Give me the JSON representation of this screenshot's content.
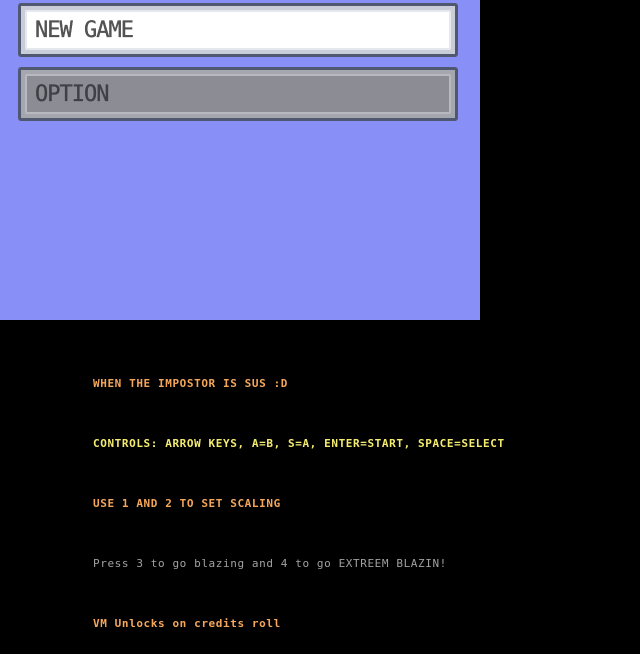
{
  "menu": {
    "new_game": "NEW GAME",
    "option": "OPTION"
  },
  "info": {
    "line1": "WHEN THE IMPOSTOR IS SUS :D",
    "line2": "CONTROLS: ARROW KEYS, A=B, S=A, ENTER=START, SPACE=SELECT",
    "line3": "USE 1 AND 2 TO SET SCALING",
    "line4": "Press 3 to go blazing and 4 to go EXTREEM BLAZIN!",
    "line5": "VM Unlocks on credits roll"
  },
  "colors": {
    "screen_bg": "#8890f8",
    "outer_bg": "#000000",
    "text_orange": "#f4a65a",
    "text_yellow": "#f4ec70",
    "text_gray": "#a0a0a0"
  }
}
